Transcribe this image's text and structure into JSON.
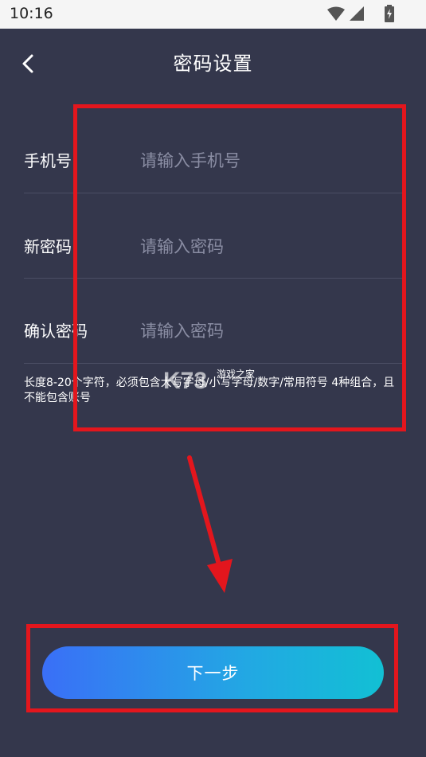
{
  "status_bar": {
    "time": "10:16"
  },
  "header": {
    "title": "密码设置"
  },
  "form": {
    "rows": [
      {
        "label": "手机号",
        "placeholder": "请输入手机号",
        "value": ""
      },
      {
        "label": "新密码",
        "placeholder": "请输入密码",
        "value": ""
      },
      {
        "label": "确认密码",
        "placeholder": "请输入密码",
        "value": ""
      }
    ],
    "hint": "长度8-20个字符，必须包含大写字母/小写字母/数字/常用符号 4种组合，且不能包含账号"
  },
  "watermark": {
    "text": "游戏之家"
  },
  "actions": {
    "next_label": "下一步"
  },
  "colors": {
    "background": "#34374c",
    "annotation": "#e3161d",
    "button_gradient_start": "#3a6ff7",
    "button_gradient_end": "#12c0d4"
  }
}
